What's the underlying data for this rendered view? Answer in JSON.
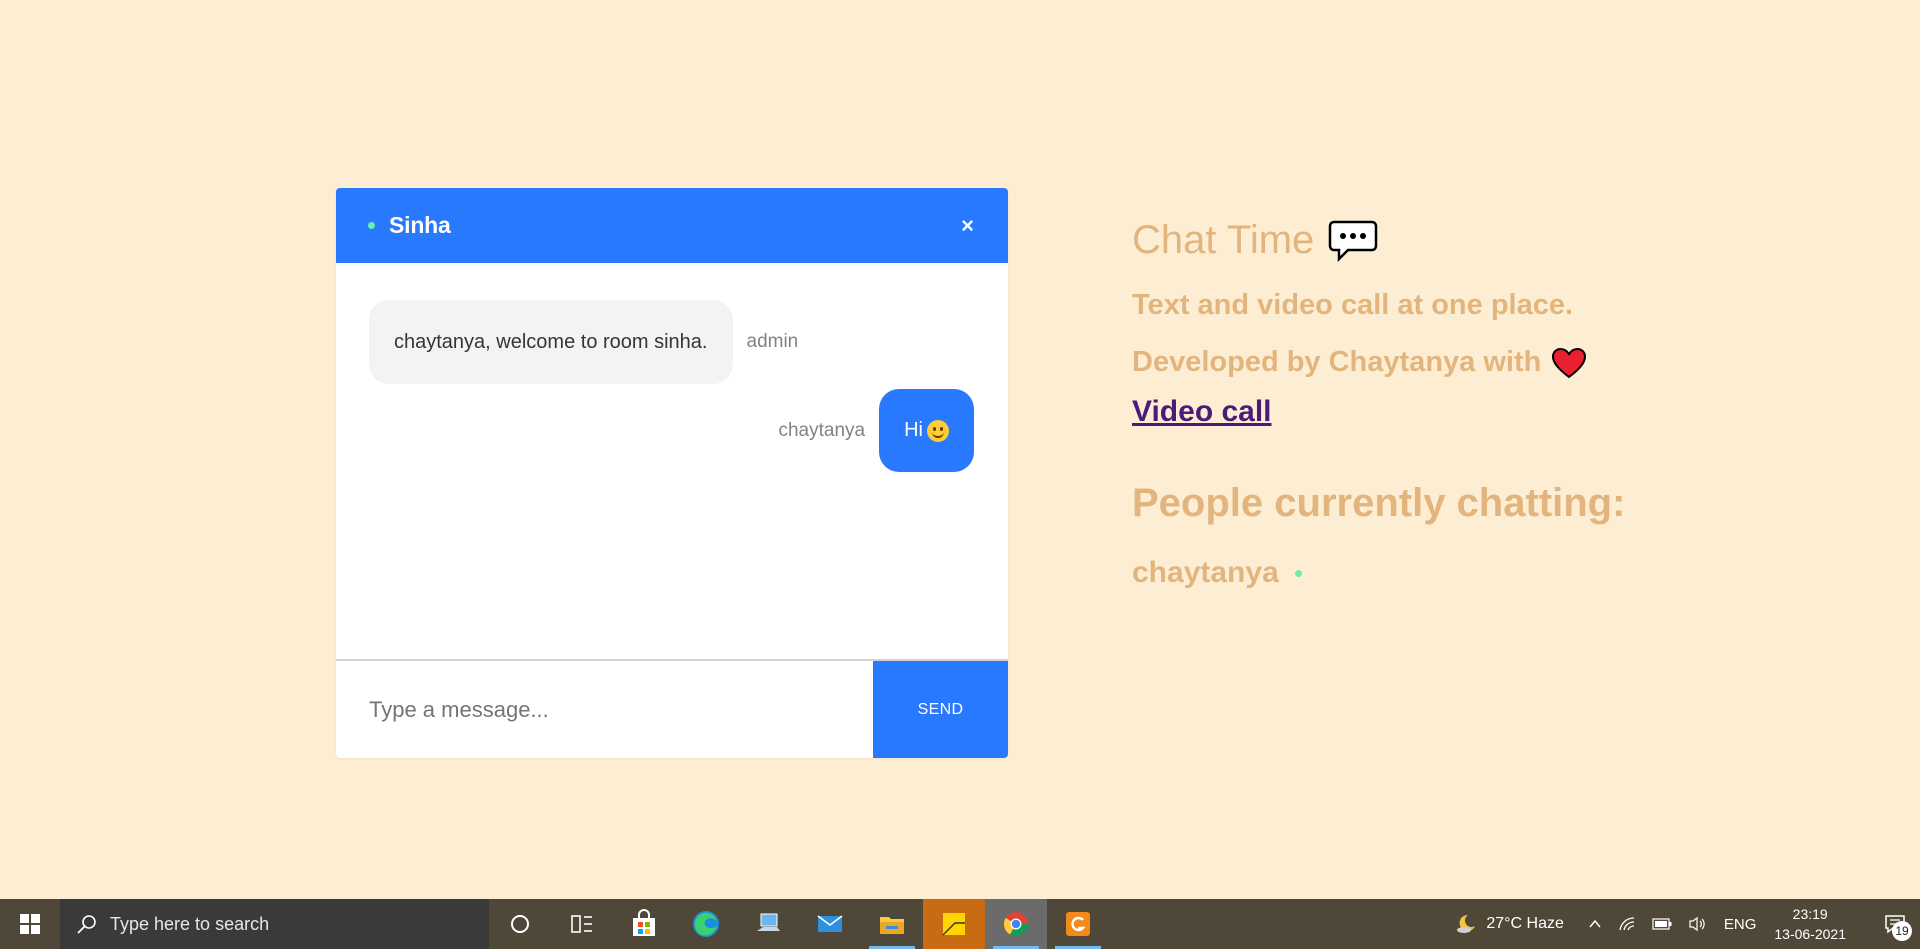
{
  "chat": {
    "room_name": "Sinha",
    "close_label": "×",
    "messages": [
      {
        "text": "chaytanya, welcome to room sinha.",
        "sender": "admin",
        "side": "left"
      },
      {
        "text": "Hi",
        "sender": "chaytanya",
        "side": "right",
        "emoji": "smile"
      }
    ],
    "input_placeholder": "Type a message...",
    "send_label": "SEND"
  },
  "info": {
    "title": "Chat Time",
    "tagline": "Text and video call at one place.",
    "developed_by": "Developed by Chaytanya with",
    "video_link": "Video call",
    "people_title": "People currently chatting:",
    "people": [
      "chaytanya"
    ]
  },
  "taskbar": {
    "search_placeholder": "Type here to search",
    "weather": "27°C  Haze",
    "language": "ENG",
    "time": "23:19",
    "date": "13-06-2021",
    "notification_count": "19"
  },
  "colors": {
    "background": "#fdeed3",
    "accent": "#2979ff",
    "online": "#69f0ae",
    "info_text": "#e3b57e",
    "link": "#4b1b7a"
  }
}
